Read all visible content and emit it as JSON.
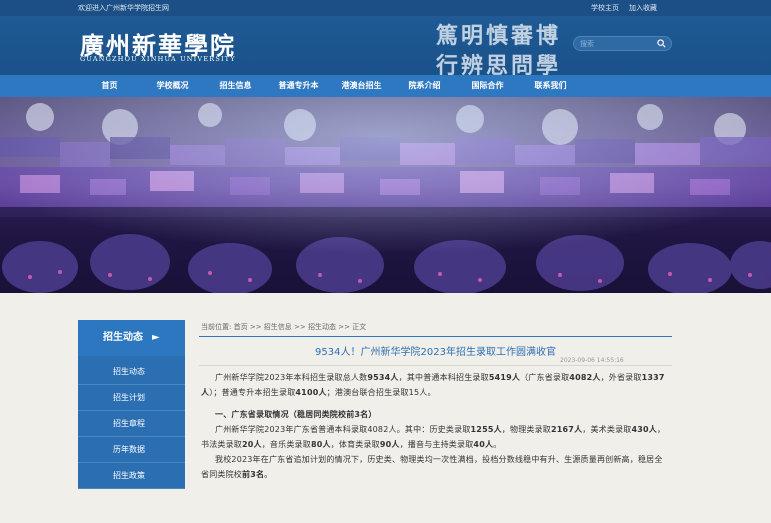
{
  "topbar": {
    "welcome": "欢迎进入广州新华学院招生网",
    "links": [
      "学校主页",
      "加入收藏"
    ]
  },
  "header": {
    "logo_cn": "廣州新華學院",
    "logo_en": "GUANGZHOU  XINHUA  UNIVERSITY",
    "motto_line1": "篤明慎審博",
    "motto_line2": "行辨思問學",
    "search_placeholder": "搜索"
  },
  "nav": [
    "首页",
    "学校概况",
    "招生信息",
    "普通专升本",
    "港澳台招生",
    "院系介绍",
    "国际合作",
    "联系我们"
  ],
  "sidebar": {
    "title": "招生动态",
    "items": [
      "招生动态",
      "招生计划",
      "招生章程",
      "历年数据",
      "招生政策"
    ]
  },
  "breadcrumb": [
    "当前位置:",
    "首页",
    ">>",
    "招生信息",
    ">>",
    "招生动态",
    ">>",
    "正文"
  ],
  "article": {
    "title": "9534人！广州新华学院2023年招生录取工作圆满收官",
    "date": "2023-09-06 14:55:16",
    "p1_pre": "广州新华学院2023年本科招生录取总人数",
    "p1_b1": "9534人",
    "p1_mid1": "，其中普通本科招生录取",
    "p1_b2": "5419人",
    "p1_mid2": "（广东省录取",
    "p1_b3": "4082人",
    "p1_mid3": "，外省录取",
    "p1_b4": "1337人",
    "p1_mid4": "）；普通专升本招生录取",
    "p1_b5": "4100人",
    "p1_end": "；港澳台联合招生录取15人。",
    "h1": "一、广东省录取情况（稳居同类院校前3名）",
    "p2_pre": "广州新华学院2023年广东省普通本科录取4082人。其中：历史类录取",
    "p2_b1": "1255人",
    "p2_mid1": "，物理类录取",
    "p2_b2": "2167人",
    "p2_mid2": "，美术类录取",
    "p2_b3": "430人",
    "p2_mid3": "，书法类录取",
    "p2_b4": "20人",
    "p2_mid4": "，音乐类录取",
    "p2_b5": "80人",
    "p2_mid5": "，体育类录取",
    "p2_b6": "90人",
    "p2_mid6": "，播音与主持类录取",
    "p2_b7": "40人",
    "p2_end": "。",
    "p3_pre": "我校2023年在广东省追加计划的情况下，历史类、物理类均一次性满档，投档分数线稳中有升、生源质量再创新高，稳居全省同类院校",
    "p3_b": "前3名",
    "p3_end": "。"
  },
  "colors": {
    "topbar": "#1b4f86",
    "header": "#1f5a94",
    "nav": "#2e78c2",
    "sidebar": "#2b6fb2",
    "title_text": "#2d6fb3",
    "page_bg": "#f0efea"
  }
}
